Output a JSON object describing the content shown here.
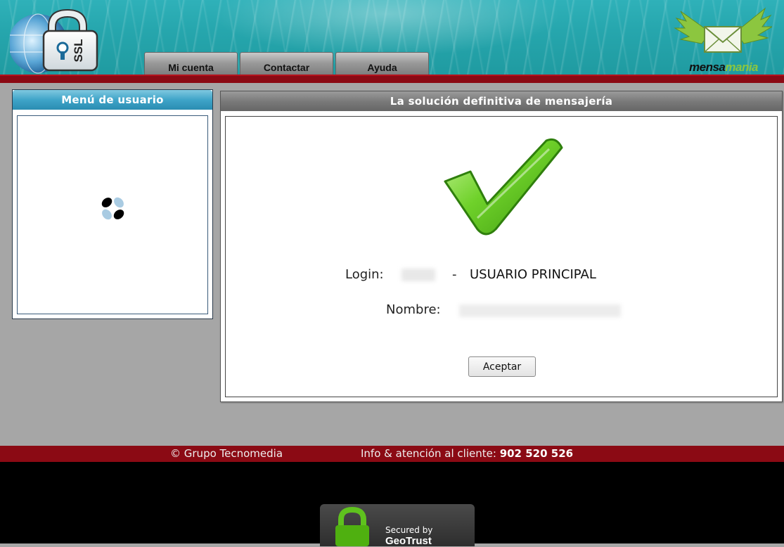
{
  "header": {
    "ssl_logo_text": "SSL",
    "nav": [
      {
        "label": "Mi cuenta"
      },
      {
        "label": "Contactar"
      },
      {
        "label": "Ayuda"
      }
    ],
    "brand_part1": "mensa",
    "brand_part2": "mania"
  },
  "sidebar": {
    "title": "Menú de usuario"
  },
  "main": {
    "title": "La solución definitiva de mensajería",
    "login_label": "Login:",
    "login_separator": "-",
    "login_role": "USUARIO PRINCIPAL",
    "name_label": "Nombre:",
    "accept_label": "Aceptar"
  },
  "footer": {
    "copyright": "© Grupo Tecnomedia",
    "info_label": "Info & atención al cliente:",
    "phone": "902 520 526"
  },
  "badge": {
    "secured_by": "Secured by",
    "brand": "GeoTrust"
  },
  "colors": {
    "header_teal": "#26a6ad",
    "header_bar_red": "#8b0a14",
    "sidebar_title_blue": "#3fa4c8",
    "main_title_gray": "#7a7a7a",
    "check_green": "#5cc21e",
    "brand_green": "#8cc63f"
  }
}
